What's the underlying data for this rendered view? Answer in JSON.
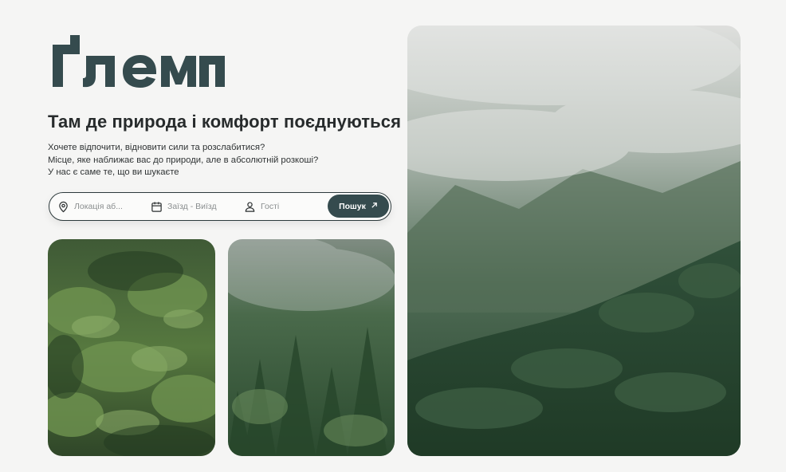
{
  "brand": {
    "logo_text": "Ґлемп",
    "color": "#354b4e"
  },
  "hero": {
    "headline": "Там де природа і комфорт поєднуються",
    "description": [
      "Хочете відпочити, відновити сили та розслабитися?",
      "Місце, яке наближає вас до природи, але в абсолютній розкоші?",
      "У нас є саме те, що ви шукаєте"
    ]
  },
  "search": {
    "location_placeholder": "Локація аб...",
    "dates_placeholder": "Заїзд - Виїзд",
    "guests_placeholder": "Гості",
    "button_label": "Пошук",
    "icons": [
      "location-pin-icon",
      "calendar-icon",
      "user-icon",
      "arrow-up-right-icon"
    ]
  },
  "gallery": {
    "images": [
      "forest-photo",
      "misty-forest-photo",
      "foggy-mountain-forest-photo"
    ]
  },
  "colors": {
    "background": "#f5f5f4",
    "accent": "#354b4e",
    "text": "#2b2f30"
  }
}
